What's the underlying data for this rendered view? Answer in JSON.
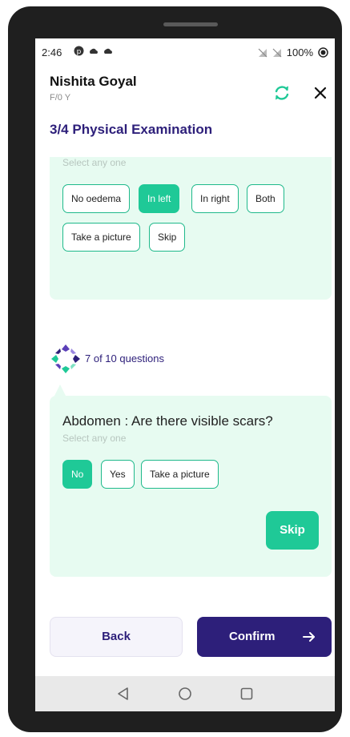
{
  "status_bar": {
    "time": "2:46",
    "battery": "100%"
  },
  "header": {
    "patient_name": "Nishita Goyal",
    "patient_meta": "F/0 Y",
    "step_title": "3/4 Physical Examination"
  },
  "previous_question": {
    "hint": "Select any one",
    "options": [
      {
        "label": "No oedema",
        "selected": false
      },
      {
        "label": "In left",
        "selected": true
      },
      {
        "label": "In right",
        "selected": false
      },
      {
        "label": "Both",
        "selected": false
      },
      {
        "label": "Take a picture",
        "selected": false
      },
      {
        "label": "Skip",
        "selected": false
      }
    ]
  },
  "progress": {
    "text": "7 of 10 questions"
  },
  "current_question": {
    "question": "Abdomen : Are there visible scars?",
    "hint": "Select any one",
    "options": [
      {
        "label": "No",
        "selected": true
      },
      {
        "label": "Yes",
        "selected": false
      },
      {
        "label": "Take a picture",
        "selected": false
      }
    ],
    "skip_label": "Skip"
  },
  "actions": {
    "back_label": "Back",
    "confirm_label": "Confirm"
  },
  "colors": {
    "primary": "#2d1f7a",
    "accent": "#1fc997",
    "card_bg": "#e7fbf1"
  }
}
